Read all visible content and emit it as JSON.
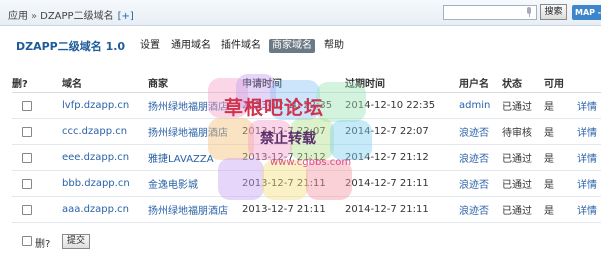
{
  "topbar": {
    "crumb_root": "应用",
    "crumb_sep": "»",
    "crumb_current": "DZAPP二级域名",
    "crumb_add": "[+]",
    "search_placeholder": "",
    "search_button": "搜索",
    "map_button": "MAP -"
  },
  "header": {
    "title": "DZAPP二级域名 1.0",
    "nav": [
      "设置",
      "通用域名",
      "插件域名",
      "商家域名",
      "帮助"
    ],
    "active_nav": "商家域名"
  },
  "table": {
    "columns": [
      "删?",
      "域名",
      "商家",
      "申请时间",
      "过期时间",
      "用户名",
      "状态",
      "可用",
      ""
    ],
    "rows": [
      {
        "domain": "lvfp.dzapp.cn",
        "merchant": "扬州绿地福朋酒店",
        "apply_time": "2013-12-10 22:35",
        "expire_time": "2014-12-10 22:35",
        "user": "admin",
        "status": "已通过",
        "available": "是",
        "action": "详情"
      },
      {
        "domain": "ccc.dzapp.cn",
        "merchant": "扬州绿地福朋酒店",
        "apply_time": "2013-12-7 22:07",
        "expire_time": "2014-12-7 22:07",
        "user": "浪迹否",
        "status": "待审核",
        "available": "是",
        "action": "详情"
      },
      {
        "domain": "eee.dzapp.cn",
        "merchant": "雅捷LAVAZZA",
        "apply_time": "2013-12-7 21:12",
        "expire_time": "2014-12-7 21:12",
        "user": "浪迹否",
        "status": "已通过",
        "available": "是",
        "action": "详情"
      },
      {
        "domain": "bbb.dzapp.cn",
        "merchant": "金逸电影城",
        "apply_time": "2013-12-7 21:11",
        "expire_time": "2014-12-7 21:11",
        "user": "浪迹否",
        "status": "已通过",
        "available": "是",
        "action": "详情"
      },
      {
        "domain": "aaa.dzapp.cn",
        "merchant": "扬州绿地福朋酒店",
        "apply_time": "2013-12-7 21:11",
        "expire_time": "2014-12-7 21:11",
        "user": "浪迹否",
        "status": "已通过",
        "available": "是",
        "action": "详情"
      }
    ]
  },
  "footer": {
    "delete_label": "删?",
    "submit_label": "提交"
  },
  "watermark": {
    "line1": "草根吧论坛",
    "line2": "禁止转载",
    "line3": "www.cgbbs.com"
  },
  "colors": {
    "link": "#2a62a8",
    "title": "#1f5a99",
    "active_nav_bg": "#6c7a86",
    "map_button": "#3d86cc",
    "watermark_main": "#d0334d"
  }
}
